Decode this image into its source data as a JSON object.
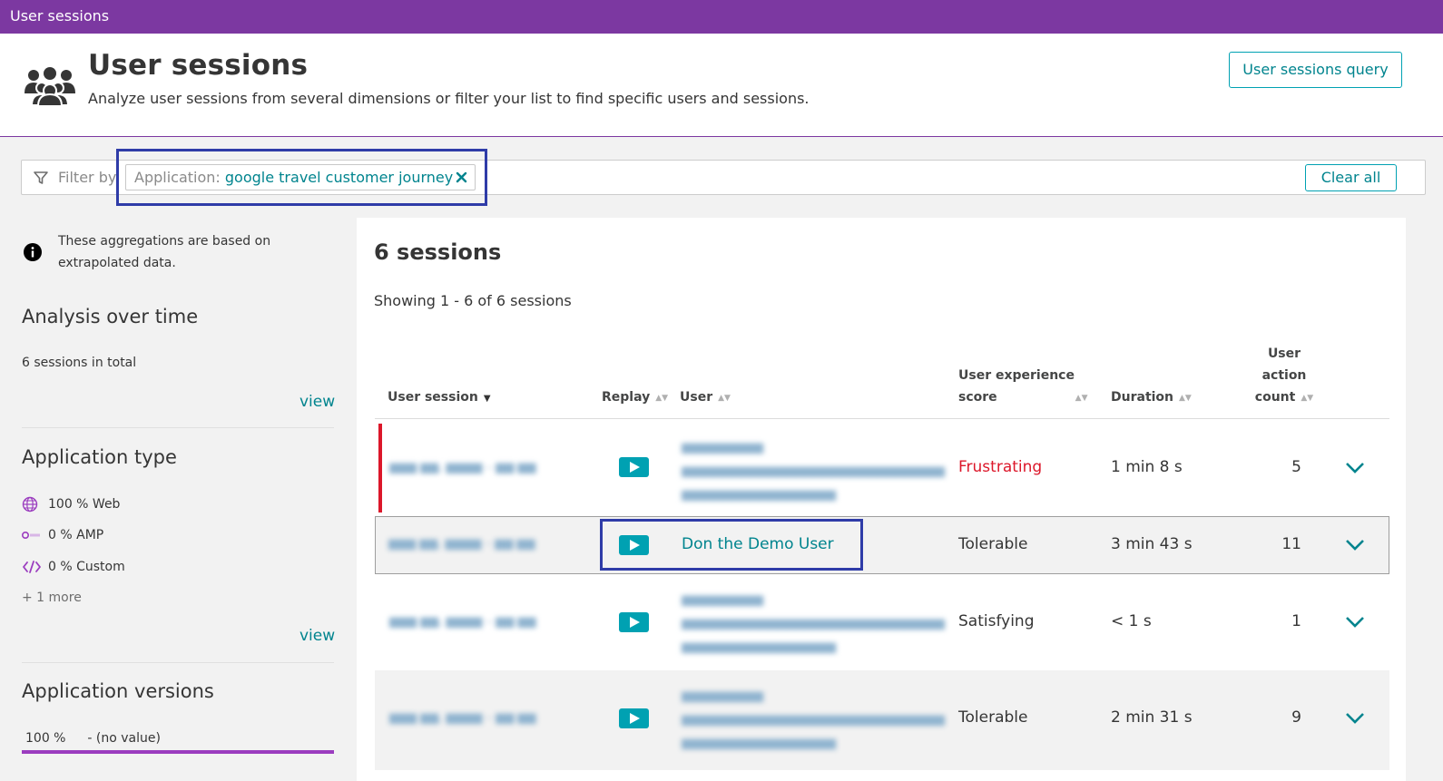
{
  "topbar": {
    "title": "User sessions"
  },
  "header": {
    "title": "User sessions",
    "subtitle": "Analyze user sessions from several dimensions or filter your list to find specific users and sessions.",
    "query_button": "User sessions query"
  },
  "filter": {
    "label": "Filter by",
    "chip_key": "Application:",
    "chip_value": "google travel customer journey",
    "clear_all": "Clear all"
  },
  "left": {
    "info_text": "These aggregations are based on extrapolated data.",
    "analysis_title": "Analysis over time",
    "sessions_total": "6 sessions in total",
    "view_label": "view",
    "app_type_title": "Application type",
    "app_types": [
      {
        "label": "100 % Web",
        "icon": "globe-icon"
      },
      {
        "label": "0 % AMP",
        "icon": "amp-icon"
      },
      {
        "label": "0 % Custom",
        "icon": "code-icon"
      }
    ],
    "more": "+ 1 more",
    "app_versions_title": "Application versions",
    "version_percent": "100 %",
    "version_value": "- (no value)"
  },
  "table": {
    "count_title": "6 sessions",
    "showing": "Showing 1 - 6 of 6 sessions",
    "columns": {
      "user_session": "User session",
      "replay": "Replay",
      "user": "User",
      "ux_score_1": "User experience",
      "ux_score_2": "score",
      "duration": "Duration",
      "action_count_1": "User",
      "action_count_2": "action",
      "action_count_3": "count"
    },
    "rows": [
      {
        "score": "Frustrating",
        "duration": "1 min 8 s",
        "count": "5",
        "user": ""
      },
      {
        "score": "Tolerable",
        "duration": "3 min 43 s",
        "count": "11",
        "user": "Don the Demo User"
      },
      {
        "score": "Satisfying",
        "duration": "< 1 s",
        "count": "1",
        "user": ""
      },
      {
        "score": "Tolerable",
        "duration": "2 min 31 s",
        "count": "9",
        "user": ""
      }
    ]
  },
  "colors": {
    "brand": "#7c38a1",
    "accent": "#00a1b2",
    "link": "#00848e",
    "frustrating": "#dc172a",
    "highlight": "#2f3ca8"
  }
}
